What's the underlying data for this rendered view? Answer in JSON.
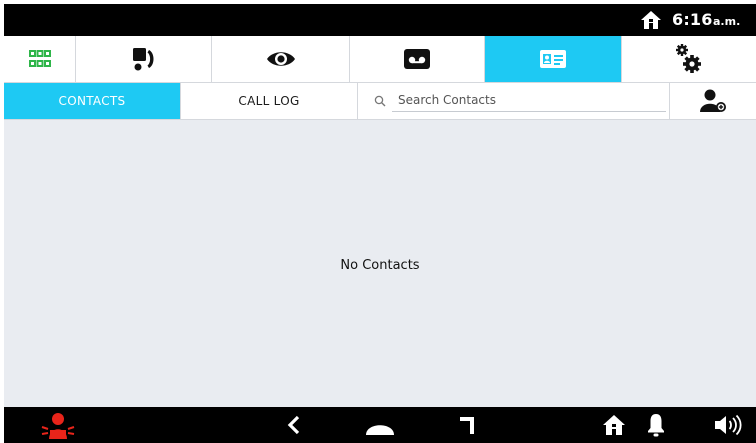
{
  "status_bar": {
    "time": "6:16",
    "ampm": "a.m.",
    "home_icon": "home-icon"
  },
  "main_tabs": [
    {
      "id": "apps",
      "icon": "app-grid-icon",
      "active": false
    },
    {
      "id": "intercom",
      "icon": "intercom-handset-icon",
      "active": false
    },
    {
      "id": "monitor",
      "icon": "eye-icon",
      "active": false
    },
    {
      "id": "voicemail",
      "icon": "voicemail-icon",
      "active": false
    },
    {
      "id": "contacts",
      "icon": "contact-card-icon",
      "active": true
    },
    {
      "id": "settings",
      "icon": "gears-icon",
      "active": false
    }
  ],
  "sub_tabs": {
    "contacts_label": "CONTACTS",
    "call_log_label": "CALL LOG",
    "search_placeholder": "Search Contacts",
    "search_value": "",
    "add_contact_icon": "add-user-icon"
  },
  "content": {
    "empty_message": "No Contacts"
  },
  "bottom_bar": {
    "icons": [
      "alarm-icon",
      "back-icon",
      "home-icon",
      "recent-apps-icon",
      "home-status-icon",
      "bell-icon",
      "volume-icon"
    ]
  },
  "colors": {
    "accent": "#1ec9f3",
    "alarm": "#e8241a",
    "grid_green": "#2fb54a",
    "background": "#e9ecf1"
  }
}
